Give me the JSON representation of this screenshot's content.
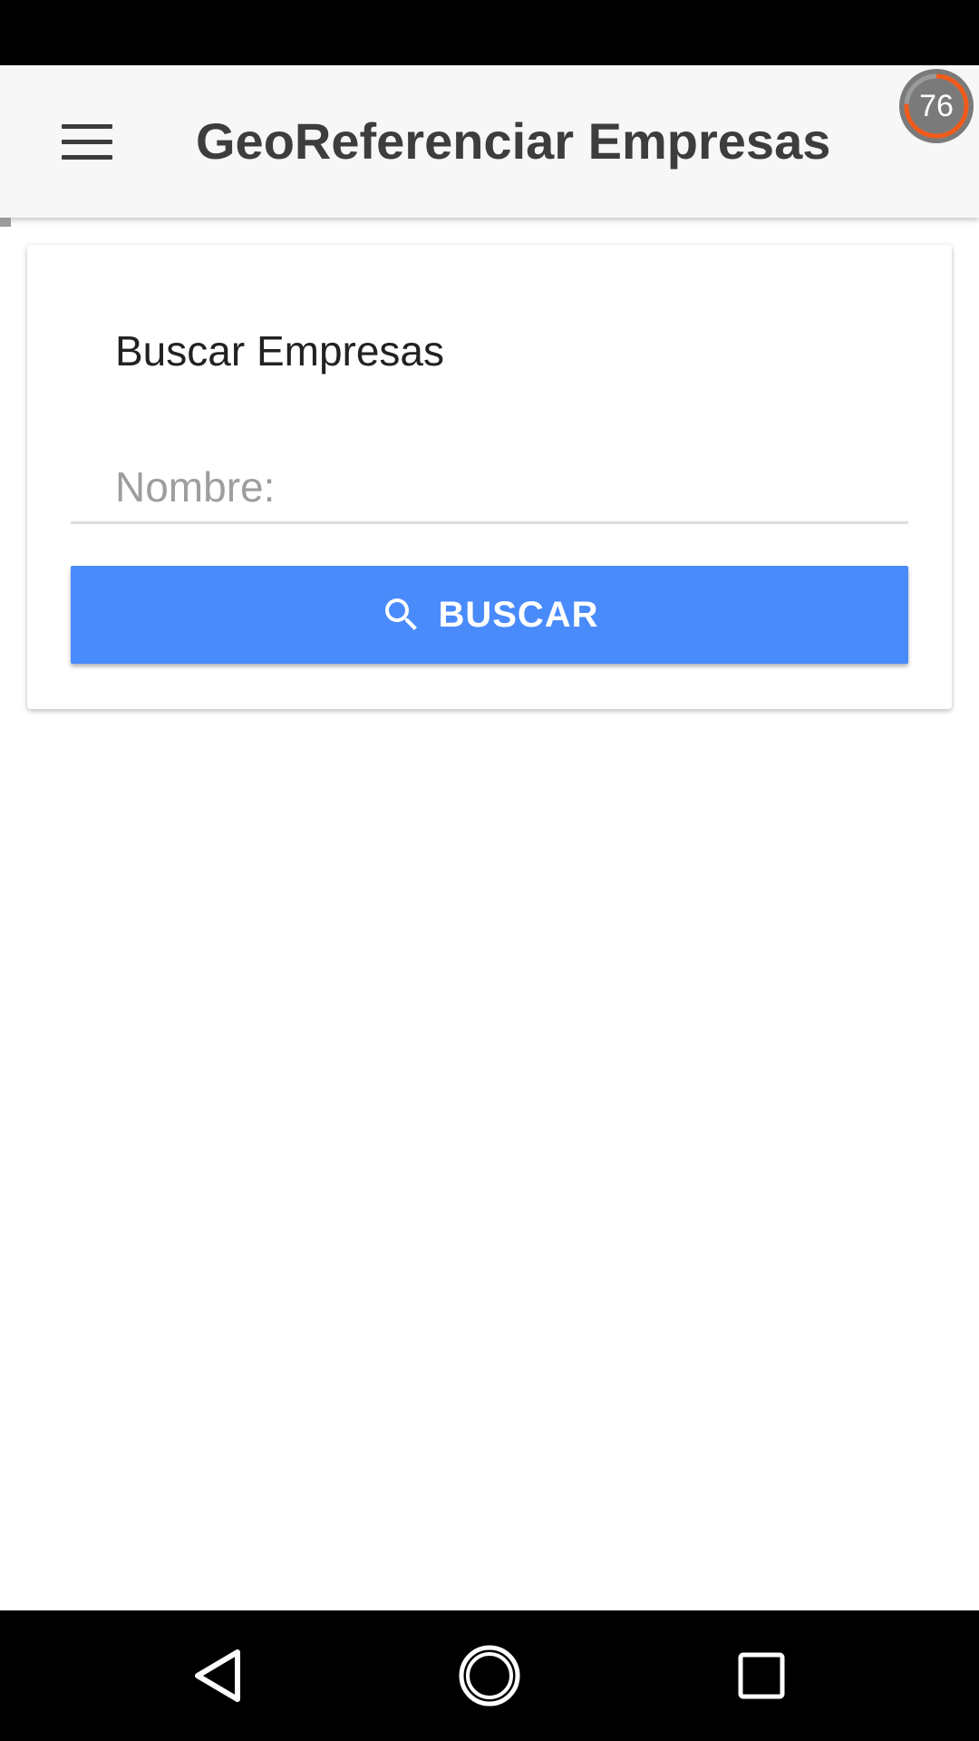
{
  "app_bar": {
    "title": "GeoReferenciar Empresas",
    "menu_icon": "hamburger-menu-icon",
    "gauge_value": "76",
    "gauge_color": "#f05a1a"
  },
  "card": {
    "title": "Buscar Empresas",
    "name_input": {
      "placeholder": "Nombre:",
      "value": ""
    },
    "search_button": {
      "label": "BUSCAR",
      "icon": "search-icon",
      "color": "#4a8bfc"
    }
  },
  "nav_bar": {
    "back_icon": "back-triangle-icon",
    "home_icon": "home-circle-icon",
    "recents_icon": "recents-square-icon"
  }
}
